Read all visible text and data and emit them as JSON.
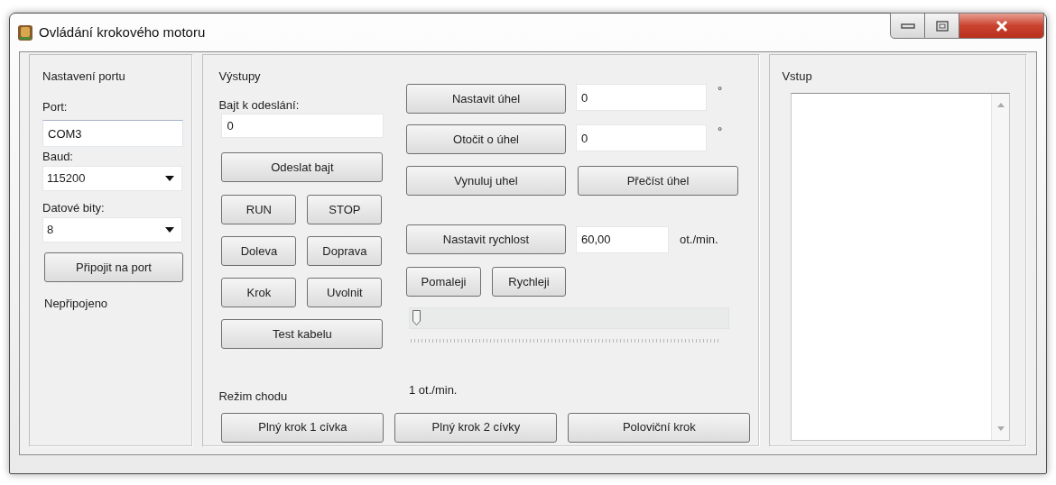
{
  "window": {
    "title": "Ovládání krokového motoru"
  },
  "port_panel": {
    "title": "Nastavení portu",
    "port_label": "Port:",
    "port_value": "COM3",
    "baud_label": "Baud:",
    "baud_value": "115200",
    "data_bits_label": "Datové bity:",
    "data_bits_value": "8",
    "connect_button": "Připojit na port",
    "status": "Nepřipojeno"
  },
  "outputs_panel": {
    "title": "Výstupy",
    "byte_label": "Bajt k odeslání:",
    "byte_value": "0",
    "send_button": "Odeslat bajt",
    "button_pairs": [
      [
        "RUN",
        "STOP"
      ],
      [
        "Doleva",
        "Doprava"
      ],
      [
        "Krok",
        "Uvolnit"
      ]
    ],
    "test_button": "Test kabelu",
    "set_angle": {
      "button": "Nastavit úhel",
      "value": "0",
      "unit": "°"
    },
    "rotate_angle": {
      "button": "Otočit o úhel",
      "value": "0",
      "unit": "°"
    },
    "reset_angle_button": "Vynuluj uhel",
    "read_angle_button": "Přečíst úhel",
    "set_speed": {
      "button": "Nastavit rychlost",
      "value": "60,00",
      "unit": "ot./min."
    },
    "slower_button": "Pomaleji",
    "faster_button": "Rychleji",
    "speed_slider": {
      "level": 0
    },
    "slider_reading": "1 ot./min.",
    "mode": {
      "title": "Režim chodu",
      "buttons": [
        "Plný krok 1 cívka",
        "Plný krok 2 cívky",
        "Poloviční krok"
      ]
    }
  },
  "input_panel": {
    "title": "Vstup"
  }
}
